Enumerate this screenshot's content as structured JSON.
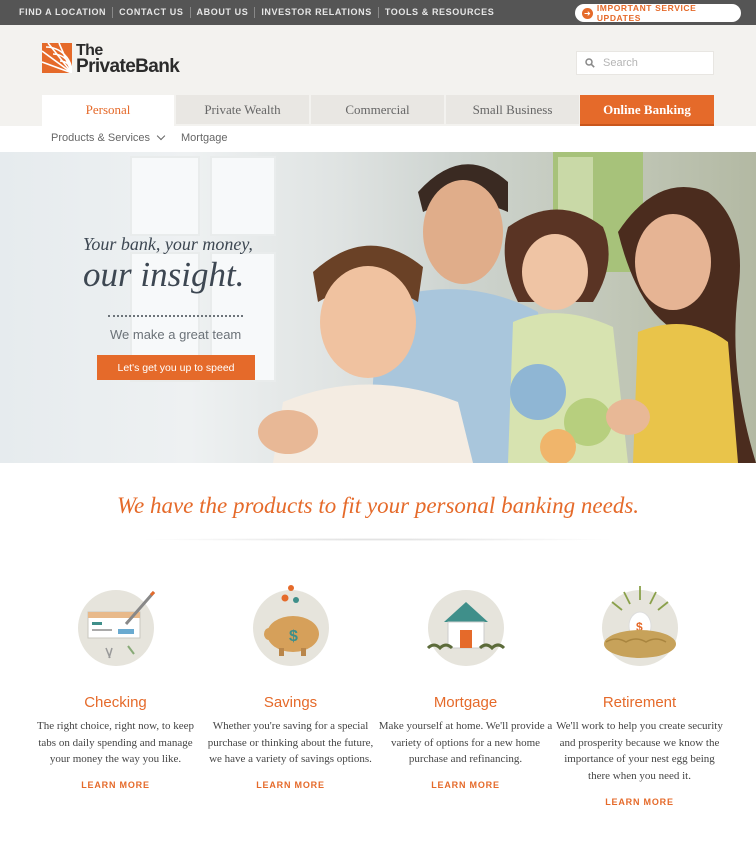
{
  "topbar": {
    "links": [
      "FIND A LOCATION",
      "CONTACT US",
      "ABOUT US",
      "INVESTOR RELATIONS",
      "TOOLS & RESOURCES"
    ],
    "important_label": "IMPORTANT SERVICE UPDATES"
  },
  "brand": {
    "line1": "The",
    "line2": "PrivateBank",
    "accent_color": "#e56a2a"
  },
  "search": {
    "placeholder": "Search"
  },
  "tabs": [
    {
      "label": "Personal",
      "active": true
    },
    {
      "label": "Private Wealth"
    },
    {
      "label": "Commercial"
    },
    {
      "label": "Small Business"
    },
    {
      "label": "Online Banking"
    }
  ],
  "subnav": {
    "products": "Products & Services",
    "mortgage": "Mortgage"
  },
  "hero": {
    "line1": "Your bank, your money,",
    "line2": "our insight.",
    "tagline": "We make a great team",
    "cta": "Let's get you up to speed"
  },
  "products_headline": "We have the products to fit your personal banking needs.",
  "products": [
    {
      "icon": "checkbook-icon",
      "title": "Checking",
      "desc": "The right choice, right now, to keep tabs on daily spending and manage your money the way you like.",
      "more": "LEARN MORE"
    },
    {
      "icon": "piggy-bank-icon",
      "title": "Savings",
      "desc": "Whether you're saving for a special purchase or thinking about the future, we have a variety of savings options.",
      "more": "LEARN MORE"
    },
    {
      "icon": "house-icon",
      "title": "Mortgage",
      "desc": "Make yourself at home. We'll provide a variety of options for a new home purchase and refinancing.",
      "more": "LEARN MORE"
    },
    {
      "icon": "nest-egg-icon",
      "title": "Retirement",
      "desc": "We'll work to help you create security and prosperity because we know the importance of your nest egg being there when you need it.",
      "more": "LEARN MORE"
    }
  ]
}
